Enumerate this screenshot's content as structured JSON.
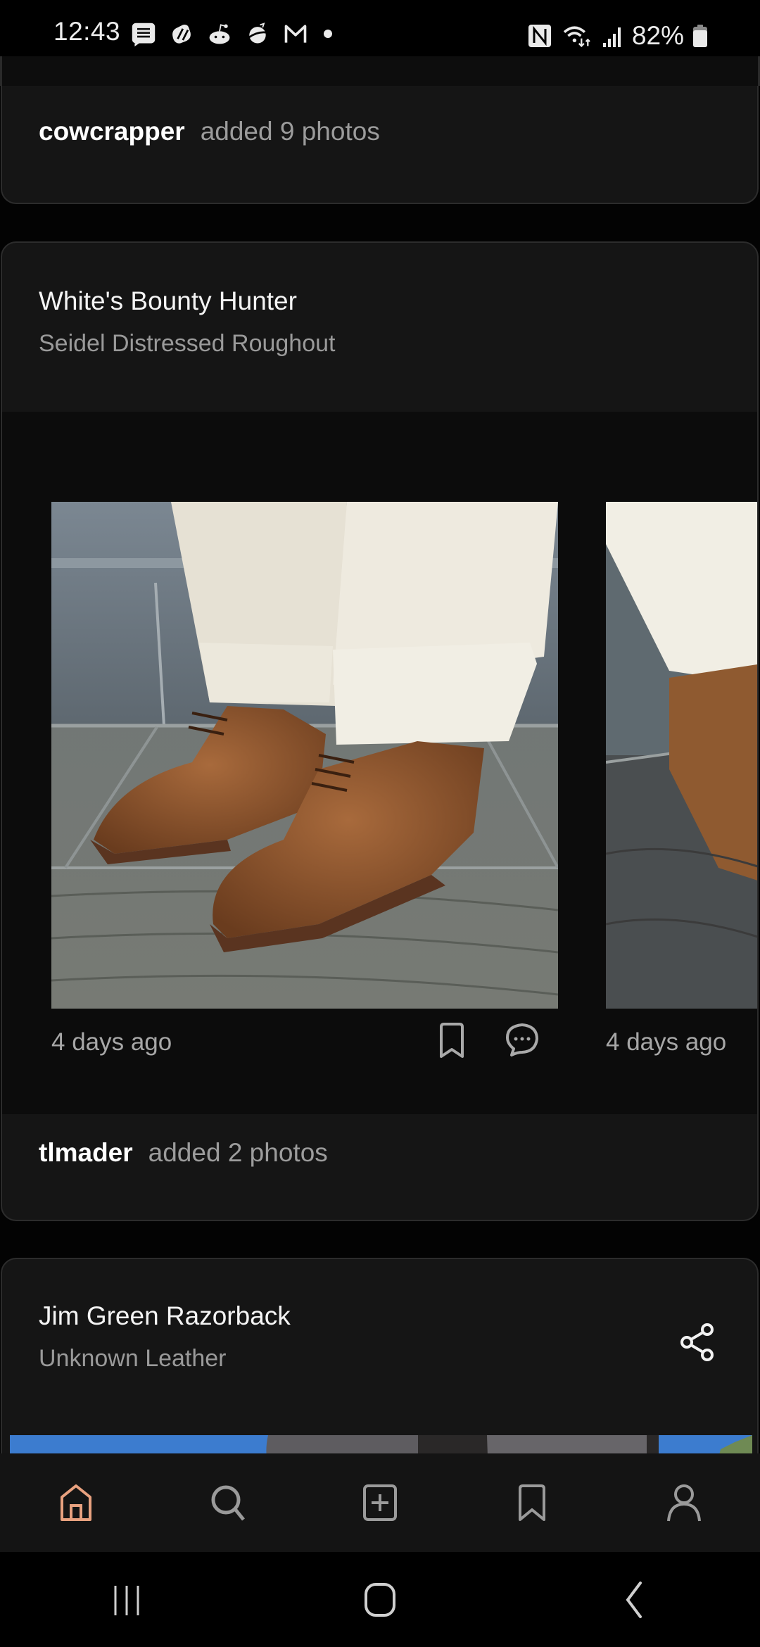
{
  "status_bar": {
    "time": "12:43",
    "notification_icons": [
      "messages-icon",
      "slack-like-icon",
      "reddit-icon",
      "planet-app-icon",
      "gmail-icon",
      "more-notifications-dot"
    ],
    "system_icons": [
      "nfc-icon",
      "wifi-icon",
      "signal-icon"
    ],
    "battery_percent": "82%",
    "battery_level": 0.82
  },
  "feed": {
    "items": [
      {
        "type": "activity",
        "user": "cowcrapper",
        "action": "added 9 photos"
      },
      {
        "type": "post",
        "title": "White's Bounty Hunter",
        "subtitle": "Seidel Distressed Roughout",
        "photos": [
          {
            "description": "Brown roughout suede lace-up boots with cuffed cream pants on grey stone tiles",
            "timestamp": "4 days ago",
            "actions": [
              "bookmark-icon",
              "comment-icon"
            ]
          },
          {
            "description": "Partial view of same boots and cuffed pants",
            "timestamp": "4 days ago"
          }
        ]
      },
      {
        "type": "activity",
        "user": "tlmader",
        "action": "added 2 photos"
      },
      {
        "type": "post",
        "title": "Jim Green Razorback",
        "subtitle": "Unknown Leather",
        "share_icon": "share-icon",
        "photo_description": "Dark boots against blue sky (partially visible)"
      }
    ]
  },
  "bottom_nav": {
    "active": "home",
    "accent_color": "#e8a17f",
    "inactive_color": "#9a9a9a",
    "items": [
      {
        "id": "home",
        "icon": "home-icon"
      },
      {
        "id": "search",
        "icon": "search-icon"
      },
      {
        "id": "add",
        "icon": "add-post-icon"
      },
      {
        "id": "saved",
        "icon": "bookmark-icon"
      },
      {
        "id": "profile",
        "icon": "profile-icon"
      }
    ]
  },
  "system_nav": {
    "items": [
      "recents-button",
      "home-button",
      "back-button"
    ]
  }
}
